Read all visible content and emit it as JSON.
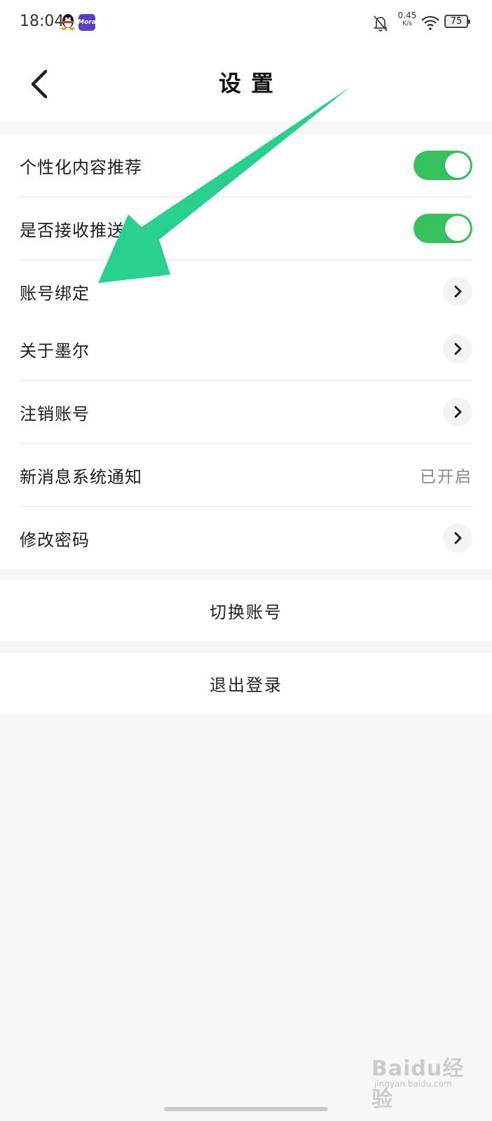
{
  "status_bar": {
    "time": "18:04",
    "app_badge": "Mora",
    "net_speed_value": "0.45",
    "net_speed_unit": "K/s",
    "battery_level": "75",
    "icons": [
      "qq-penguin-icon",
      "app-badge-icon",
      "bell-off-icon",
      "wifi-icon",
      "battery-icon"
    ]
  },
  "header": {
    "title": "设置",
    "back_icon": "chevron-left-icon"
  },
  "settings": {
    "items": [
      {
        "label": "个性化内容推荐",
        "control": "toggle",
        "on": true
      },
      {
        "label": "是否接收推送",
        "control": "toggle",
        "on": true
      },
      {
        "label": "账号绑定",
        "control": "chevron"
      },
      {
        "label": "关于墨尔",
        "control": "chevron"
      },
      {
        "label": "注销账号",
        "control": "chevron"
      },
      {
        "label": "新消息系统通知",
        "control": "value",
        "value": "已开启"
      },
      {
        "label": "修改密码",
        "control": "chevron"
      }
    ]
  },
  "actions": {
    "switch_account": "切换账号",
    "logout": "退出登录"
  },
  "watermark": {
    "brand": "Baidu经验",
    "url": "jingyan.baidu.com"
  },
  "colors": {
    "toggle_on": "#35c25c",
    "annotation_arrow": "#27d08f",
    "background": "#f7f7f7"
  }
}
